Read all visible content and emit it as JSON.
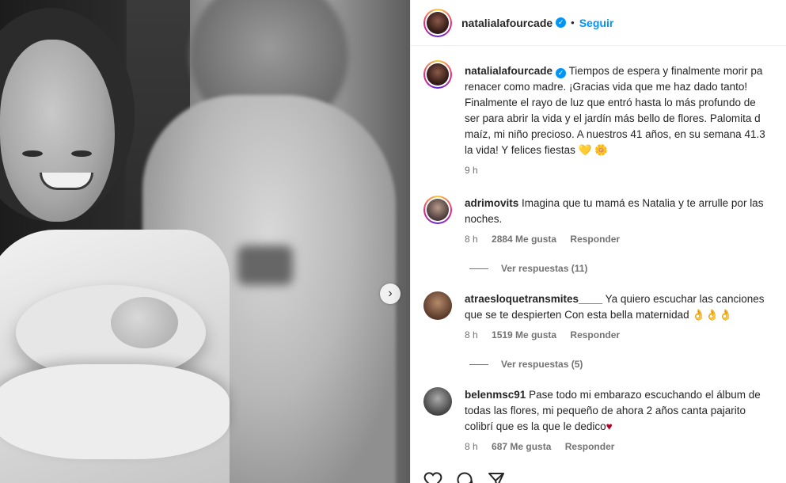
{
  "post": {
    "username": "natalialafourcade",
    "follow_label": "Seguir",
    "separator": "•",
    "next_arrow": "›"
  },
  "caption": {
    "username": "natalialafourcade",
    "lines": [
      "Tiempos de espera y finalmente morir pa",
      "renacer como madre. ¡Gracias vida que me haz dado tanto!",
      "Finalmente el rayo de luz que entró hasta lo más profundo de",
      "ser para abrir la vida y el jardín más bello de flores. Palomita d",
      "maíz, mi niño precioso. A nuestros 41 años, en su semana 41.3",
      "la vida! Y felices fiestas 💛 🌼"
    ],
    "time": "9 h"
  },
  "comments": [
    {
      "username": "adrimovits",
      "line1": "Imagina que tu mamá es Natalia y te arrulle por las",
      "line2": "noches.",
      "time": "8 h",
      "likes": "2884 Me gusta",
      "reply": "Responder",
      "view_replies": "Ver respuestas (11)"
    },
    {
      "username": "atraesloquetransmites____",
      "line1": "Ya quiero escuchar las canciones",
      "line2": "que se te despierten Con esta bella maternidad 👌👌👌",
      "time": "8 h",
      "likes": "1519 Me gusta",
      "reply": "Responder",
      "view_replies": "Ver respuestas (5)"
    },
    {
      "username": "belenmsc91",
      "line1": "Pase todo mi embarazo escuchando el álbum de",
      "line2": "todas las flores, mi pequeño de ahora 2 años canta pajarito",
      "line3": "colibrí que es la que le dedico",
      "heart": "♥",
      "time": "8 h",
      "likes": "687 Me gusta",
      "reply": "Responder"
    }
  ],
  "colors": {
    "accent": "#0095f6",
    "muted": "#737373",
    "text": "#262626"
  }
}
